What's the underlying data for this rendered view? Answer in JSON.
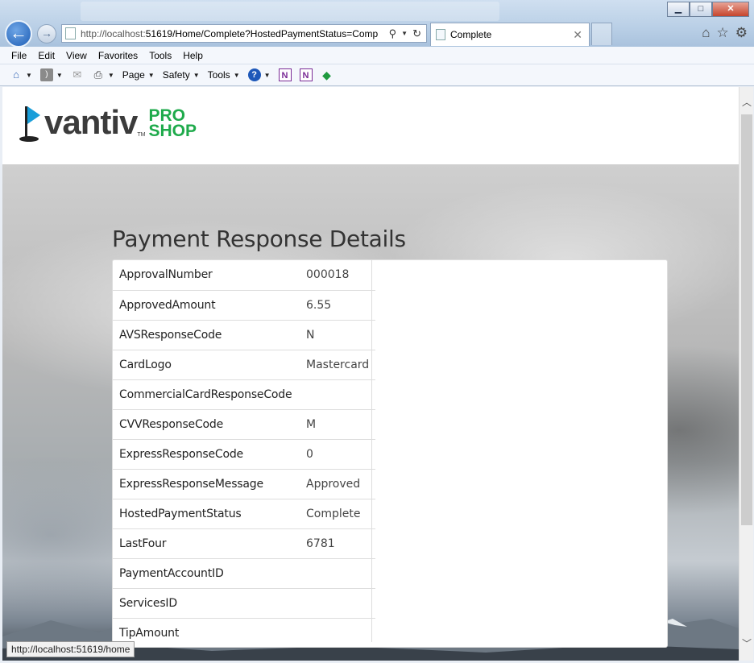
{
  "browser": {
    "window_controls": {
      "minimize": "▁",
      "maximize": "□",
      "close": "✕"
    },
    "url_host": "http://localhost:",
    "url_rest": "51619/Home/Complete?HostedPaymentStatus=Comp",
    "active_tab_title": "Complete",
    "status_url": "http://localhost:51619/home"
  },
  "menu": {
    "file": "File",
    "edit": "Edit",
    "view": "View",
    "favorites": "Favorites",
    "tools": "Tools",
    "help": "Help"
  },
  "command_bar": {
    "page": "Page",
    "safety": "Safety",
    "tools": "Tools"
  },
  "site": {
    "brand": "vantiv",
    "brand_tm": "TM",
    "sub_brand_top": "PRO",
    "sub_brand_bottom": "SHOP",
    "page_title": "Payment Response Details"
  },
  "details": [
    {
      "key": "ApprovalNumber",
      "value": "000018"
    },
    {
      "key": "ApprovedAmount",
      "value": "6.55"
    },
    {
      "key": "AVSResponseCode",
      "value": "N"
    },
    {
      "key": "CardLogo",
      "value": "Mastercard"
    },
    {
      "key": "CommercialCardResponseCode",
      "value": ""
    },
    {
      "key": "CVVResponseCode",
      "value": "M"
    },
    {
      "key": "ExpressResponseCode",
      "value": "0"
    },
    {
      "key": "ExpressResponseMessage",
      "value": "Approved"
    },
    {
      "key": "HostedPaymentStatus",
      "value": "Complete"
    },
    {
      "key": "LastFour",
      "value": "6781"
    },
    {
      "key": "PaymentAccountID",
      "value": ""
    },
    {
      "key": "ServicesID",
      "value": ""
    },
    {
      "key": "TipAmount",
      "value": ""
    }
  ],
  "colors": {
    "brand_gray": "#3b3b3b",
    "brand_green": "#1eaa4b",
    "flag_blue": "#1a9ed9"
  }
}
